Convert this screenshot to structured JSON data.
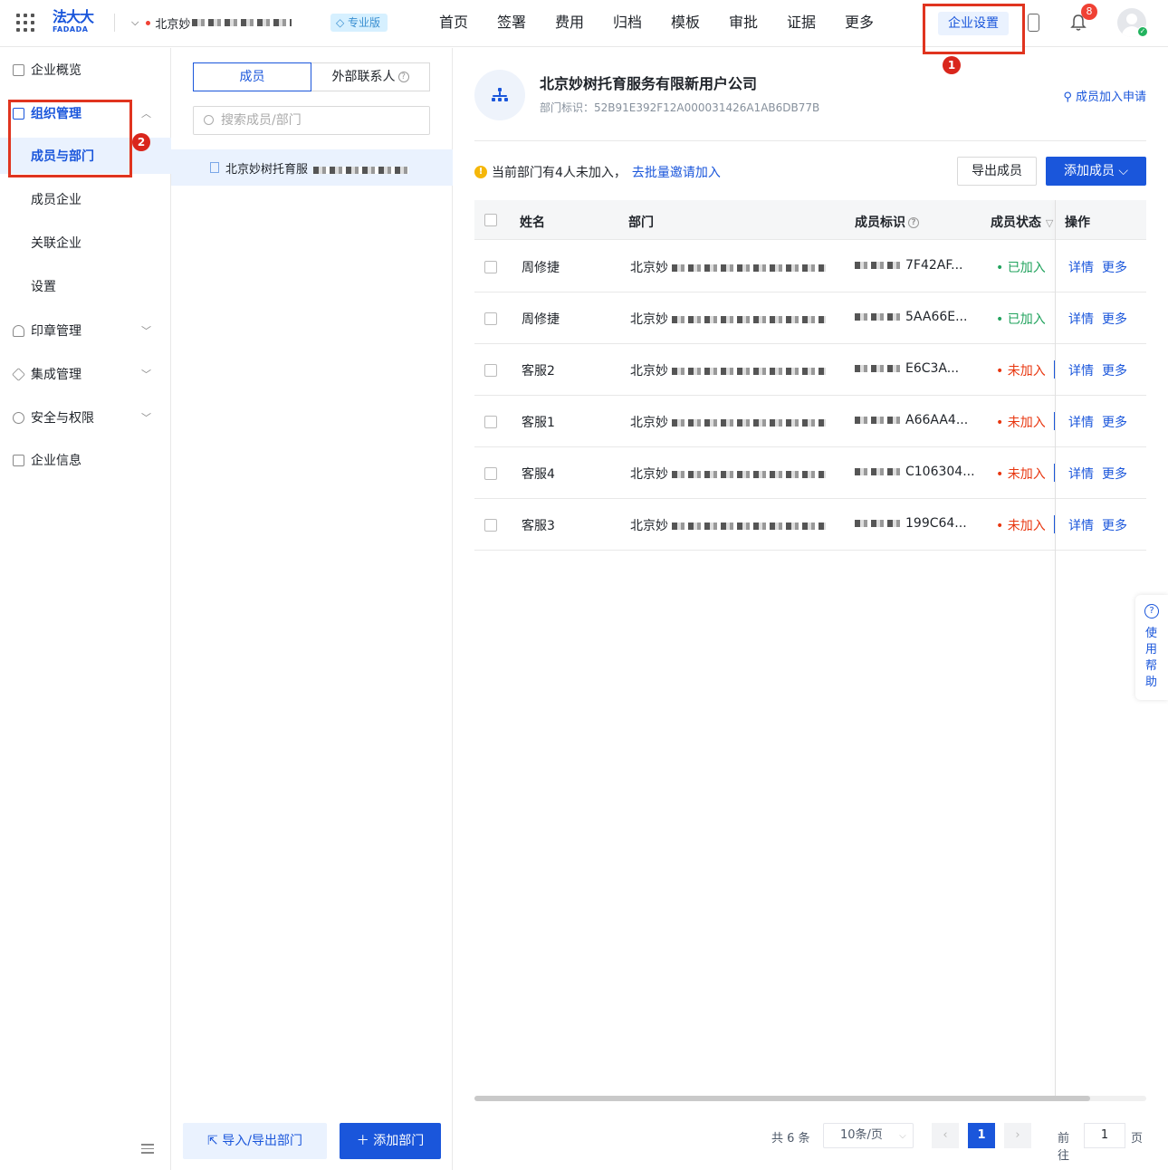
{
  "topbar": {
    "logo_cn": "法大大",
    "logo_en": "FADADA",
    "company_name": "北京妙",
    "plan_badge": "专业版",
    "nav": [
      "首页",
      "签署",
      "费用",
      "归档",
      "模板",
      "审批",
      "证据",
      "更多"
    ],
    "enterprise_settings": "企业设置",
    "notification_count": "8",
    "annotation_1": "1"
  },
  "sidebar": {
    "overview": "企业概览",
    "org_mgmt": "组织管理",
    "members_depts": "成员与部门",
    "member_companies": "成员企业",
    "related_companies": "关联企业",
    "settings": "设置",
    "seal_mgmt": "印章管理",
    "integration_mgmt": "集成管理",
    "security": "安全与权限",
    "company_info": "企业信息",
    "annotation_2": "2"
  },
  "dept_panel": {
    "tab_members": "成员",
    "tab_external": "外部联系人",
    "search_placeholder": "搜索成员/部门",
    "tree_root": "北京妙树托育服",
    "btn_import_export": "导入/导出部门",
    "btn_add_dept": "添加部门"
  },
  "main": {
    "org_title": "北京妙树托育服务有限新用户公司",
    "org_id_label": "部门标识：52B91E392F12A000031426A1AB6DB77B",
    "join_requests": "成员加入申请",
    "warning_text": "当前部门有4人未加入，",
    "warning_link": "去批量邀请加入",
    "btn_export": "导出成员",
    "btn_add_member": "添加成员",
    "columns": {
      "name": "姓名",
      "dept": "部门",
      "member_id": "成员标识",
      "status": "成员状态",
      "actions": "操作"
    },
    "rows": [
      {
        "name": "周修捷",
        "dept": "北京妙",
        "member_id": "7F42AF...",
        "status": "已加入",
        "joined": true
      },
      {
        "name": "周修捷",
        "dept": "北京妙",
        "member_id": "5AA66E...",
        "status": "已加入",
        "joined": true
      },
      {
        "name": "客服2",
        "dept": "北京妙",
        "member_id": "E6C3A...",
        "status": "未加入",
        "joined": false
      },
      {
        "name": "客服1",
        "dept": "北京妙",
        "member_id": "A66AA4...",
        "status": "未加入",
        "joined": false
      },
      {
        "name": "客服4",
        "dept": "北京妙",
        "member_id": "C106304...",
        "status": "未加入",
        "joined": false
      },
      {
        "name": "客服3",
        "dept": "北京妙",
        "member_id": "199C64...",
        "status": "未加入",
        "joined": false
      }
    ],
    "action_detail": "详情",
    "action_more": "更多"
  },
  "pagination": {
    "total": "共 6 条",
    "page_size": "10条/页",
    "current_page": "1",
    "goto_label": "前往",
    "goto_value": "1",
    "page_unit": "页"
  },
  "help": {
    "label": "使用帮助"
  },
  "colors": {
    "accent": "#1a56db",
    "joined": "#22a35e",
    "not_joined": "#e8360f",
    "annotation": "#e0341f"
  }
}
